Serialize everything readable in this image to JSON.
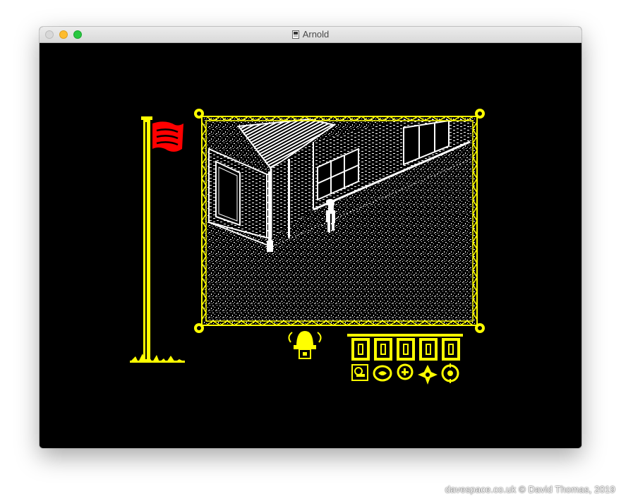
{
  "window": {
    "title": "Arnold",
    "buttons": [
      "close",
      "minimize",
      "zoom"
    ]
  },
  "game": {
    "flag_color": "#ff0000",
    "pole_color": "#ffff00",
    "frame_color": "#ffff00",
    "scene_color": "#ffffff",
    "background_color": "#000000",
    "icons": [
      "flag-icon",
      "alarm-bell-icon",
      "key-icon",
      "compass-icon",
      "button-icon",
      "cross-medal-icon",
      "target-medal-icon"
    ],
    "inventory_slots": 5,
    "medals": 5
  },
  "watermark": "davespace.co.uk © David Thomas, 2019"
}
